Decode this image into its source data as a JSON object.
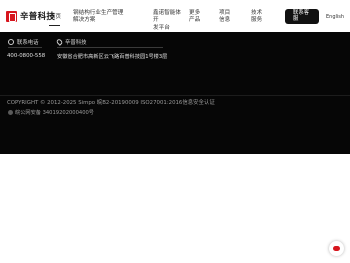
{
  "header": {
    "logo_text": "辛普科技",
    "home_label": "首页",
    "nav": [
      {
        "line1": "钢结构行业生产管理",
        "line2": "解决方案"
      },
      {
        "line1": "鑫诺智能体开",
        "line2": "发平台"
      },
      {
        "line1": "更多",
        "line2": "产品"
      },
      {
        "line1": "项目",
        "line2": "信息"
      },
      {
        "line1": "技术",
        "line2": "服务"
      }
    ],
    "contact_button": {
      "line1": "联系客",
      "line2": "服"
    },
    "language": "English"
  },
  "footer": {
    "phone_heading": "联系电话",
    "phone": "400-0800-558",
    "address_heading": "辛普科技",
    "address": "安徽省合肥市高新区云飞路百普科技园1号楼3层",
    "copyright": "COPYRIGHT © 2012-2025 Simpo 皖B2-20190009 ISO27001:2016信息安全认证",
    "police_record": "皖公网安备 34019202000400号"
  },
  "icons": {
    "phone": "phone-icon",
    "location": "location-pin-icon",
    "police": "police-badge-icon",
    "chat": "chat-bubble-icon"
  },
  "colors": {
    "brand_red": "#d7161e",
    "footer_bg": "#060606",
    "button_bg": "#111111"
  }
}
